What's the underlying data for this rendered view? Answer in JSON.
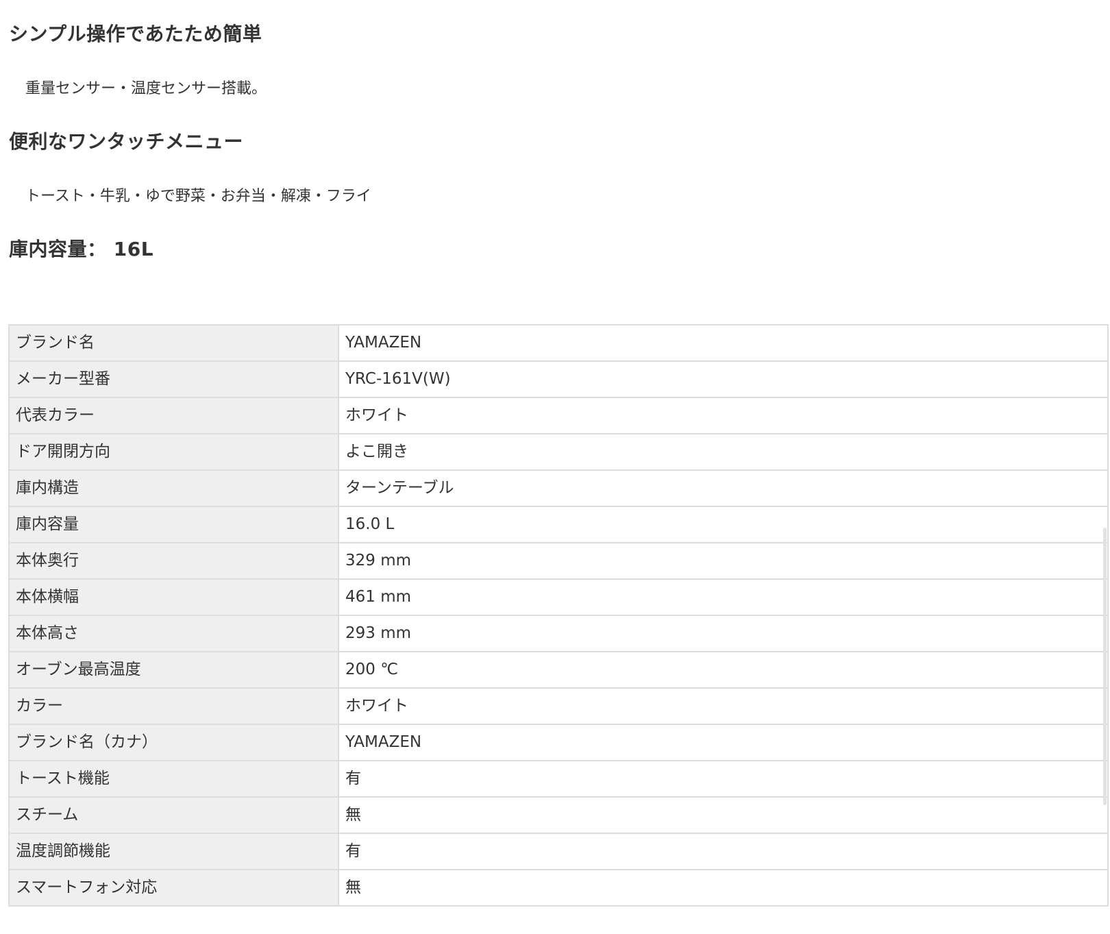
{
  "sections": [
    {
      "heading": "シンプル操作であたため簡単",
      "text": "重量センサー・温度センサー搭載。"
    },
    {
      "heading": "便利なワンタッチメニュー",
      "text": "トースト・牛乳・ゆで野菜・お弁当・解凍・フライ"
    }
  ],
  "capacity_heading": "庫内容量： 16L",
  "spec_table": {
    "rows": [
      {
        "label": "ブランド名",
        "value": "YAMAZEN"
      },
      {
        "label": "メーカー型番",
        "value": "YRC-161V(W)"
      },
      {
        "label": "代表カラー",
        "value": "ホワイト"
      },
      {
        "label": "ドア開閉方向",
        "value": "よこ開き"
      },
      {
        "label": "庫内構造",
        "value": "ターンテーブル"
      },
      {
        "label": "庫内容量",
        "value": "16.0 L"
      },
      {
        "label": "本体奥行",
        "value": "329 mm"
      },
      {
        "label": "本体横幅",
        "value": "461 mm"
      },
      {
        "label": "本体高さ",
        "value": "293 mm"
      },
      {
        "label": "オーブン最高温度",
        "value": "200 ℃"
      },
      {
        "label": "カラー",
        "value": "ホワイト"
      },
      {
        "label": "ブランド名（カナ）",
        "value": "YAMAZEN"
      },
      {
        "label": "トースト機能",
        "value": "有"
      },
      {
        "label": "スチーム",
        "value": "無"
      },
      {
        "label": "温度調節機能",
        "value": "有"
      },
      {
        "label": "スマートフォン対応",
        "value": "無"
      }
    ]
  }
}
